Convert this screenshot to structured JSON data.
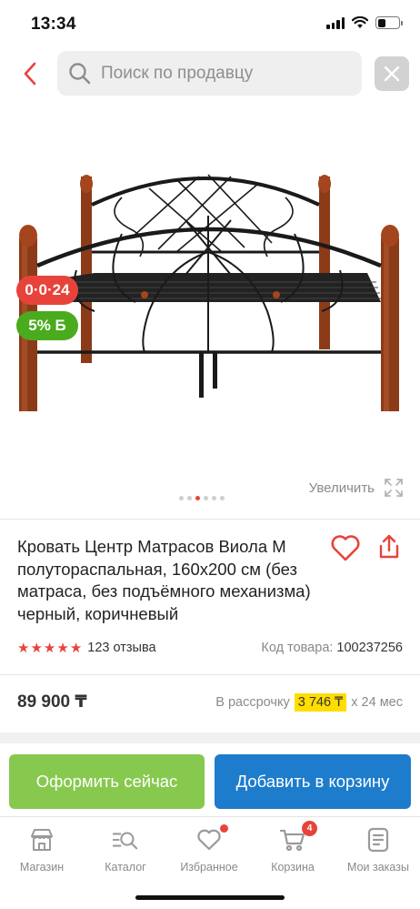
{
  "status_bar": {
    "time": "13:34"
  },
  "search": {
    "placeholder": "Поиск по продавцу"
  },
  "gallery": {
    "badge_installment": "0·0·24",
    "badge_bonus": "5% Б",
    "zoom_label": "Увеличить",
    "dots_count": 6,
    "active_dot": 3
  },
  "product": {
    "title": "Кровать Центр Матрасов Виола М полутораспальная, 160x200 см (без матраса, без подъёмного механизма) черный, коричневый",
    "rating": 5,
    "reviews": "123 отзыва",
    "sku_label": "Код товара:",
    "sku": "100237256",
    "price": "89 900 ₸",
    "installment_label": "В рассрочку",
    "installment_amount": "3 746 ₸",
    "installment_term": "х 24 мес"
  },
  "actions": {
    "checkout": "Оформить сейчас",
    "add_to_cart": "Добавить в корзину"
  },
  "tab_bar": {
    "items": [
      {
        "label": "Магазин",
        "icon": "store-icon"
      },
      {
        "label": "Каталог",
        "icon": "catalog-icon"
      },
      {
        "label": "Избранное",
        "icon": "heart-icon"
      },
      {
        "label": "Корзина",
        "icon": "cart-icon"
      },
      {
        "label": "Мои заказы",
        "icon": "orders-icon"
      }
    ],
    "cart_count": "4"
  },
  "colors": {
    "accent_red": "#e8433a",
    "bonus_green": "#4aab1e",
    "checkout_green": "#87c94f",
    "cart_blue": "#1e7ccc",
    "installment_yellow": "#ffdd00"
  }
}
